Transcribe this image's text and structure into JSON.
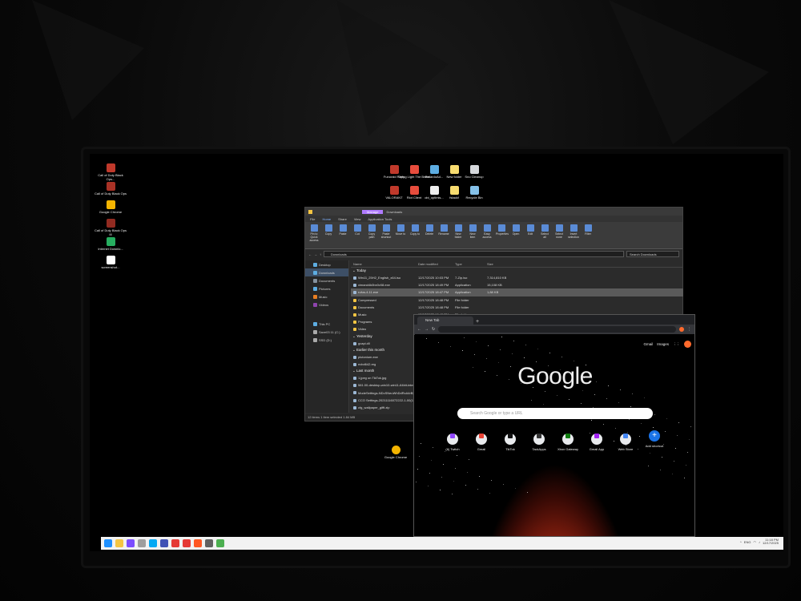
{
  "desktop": {
    "left_icons": [
      {
        "label": "Call of Duty Black Ops...",
        "color": "#c0392b"
      },
      {
        "label": "Call of Duty Black Ops",
        "color": "#a93226"
      },
      {
        "label": "Google Chrome",
        "color": "#f4b400"
      },
      {
        "label": "Call of Duty Black Ops III",
        "color": "#922b21"
      },
      {
        "label": "Internet Downlo...",
        "color": "#27ae60"
      },
      {
        "label": "screenshot...",
        "color": "#ffffff"
      }
    ],
    "top_icons": [
      {
        "label": "Funoraid Party",
        "color": "#c0392b"
      },
      {
        "label": "Dying Light The Beast",
        "color": "#e74c3c"
      },
      {
        "label": "RetardoAd...",
        "color": "#5dade2"
      },
      {
        "label": "New folder",
        "color": "#f7dc6f"
      },
      {
        "label": "Sno Cleanup",
        "color": "#d5d8dc"
      },
      {
        "label": "VALORANT",
        "color": "#c0392b"
      },
      {
        "label": "Riot Client",
        "color": "#e74c3c"
      },
      {
        "label": "obi_optimis...",
        "color": "#eeeeee"
      },
      {
        "label": "fstackf",
        "color": "#f7dc6f"
      },
      {
        "label": "Recycle Bin",
        "color": "#85c1e9"
      }
    ],
    "lower_icon": {
      "label": "Google Chrome",
      "color": "#f4b400"
    }
  },
  "explorer": {
    "title": "Downloads",
    "manage_tab": "Manage",
    "ribbon_tabs": [
      "File",
      "Home",
      "Share",
      "View",
      "Application Tools"
    ],
    "ribbon_buttons": [
      "Pin to Quick access",
      "Copy",
      "Paste",
      "Cut",
      "Copy path",
      "Paste shortcut",
      "Move to",
      "Copy to",
      "Delete",
      "Rename",
      "New folder",
      "New item",
      "Easy access",
      "Properties",
      "Open",
      "Edit",
      "Select all",
      "Select none",
      "Invert selection",
      "Filter"
    ],
    "ribbon_groups": [
      "Clipboard",
      "Organize",
      "New",
      "Open",
      "Select",
      "Filter"
    ],
    "address": "Downloads",
    "search_placeholder": "Search Downloads",
    "nav_items": [
      {
        "label": "Desktop",
        "color": "#5dade2"
      },
      {
        "label": "Downloads",
        "color": "#5dade2"
      },
      {
        "label": "Documents",
        "color": "#85929e"
      },
      {
        "label": "Pictures",
        "color": "#5dade2"
      },
      {
        "label": "Music",
        "color": "#e67e22"
      },
      {
        "label": "Videos",
        "color": "#8e44ad"
      },
      {
        "label": "This PC",
        "color": "#5dade2"
      },
      {
        "label": "Save03 11 (C:)",
        "color": "#aaa"
      },
      {
        "label": "SSD (D:)",
        "color": "#aaa"
      }
    ],
    "columns": [
      "Name",
      "Date modified",
      "Type",
      "Size"
    ],
    "groups": [
      {
        "title": "Today",
        "rows": [
          [
            "Win11_25H2_English_x64.iso",
            "12/17/2025 10:03 PM",
            "7-Zip.iso",
            "7,314,810 KB"
          ],
          [
            "ximand4k0bx0v08.exe",
            "12/17/2025 18:49 PM",
            "Application",
            "15,108 KB"
          ],
          [
            "rufus-4.11.exe",
            "12/17/2025 18:47 PM",
            "Application",
            "1,88 KB"
          ],
          [
            "Compressed",
            "12/17/2025 18:48 PM",
            "File folder",
            ""
          ],
          [
            "Documents",
            "12/17/2025 18:48 PM",
            "File folder",
            ""
          ],
          [
            "Music",
            "12/17/2025 18:48 PM",
            "File folder",
            ""
          ],
          [
            "Programs",
            "12/17/2025 18:48 PM",
            "File folder",
            ""
          ],
          [
            "Video",
            "12/17/2025 18:48 PM",
            "File folder",
            ""
          ]
        ]
      },
      {
        "title": "Yesterday",
        "rows": [
          [
            "gcapi.dll",
            "",
            "",
            ""
          ]
        ]
      },
      {
        "title": "Earlier this month",
        "rows": [
          [
            "plutonium.exe",
            "",
            "",
            ""
          ],
          [
            "nvbd642.reg",
            "",
            "",
            ""
          ]
        ]
      },
      {
        "title": "Last month",
        "rows": [
          [
            "1.jpeg on TikTok.jpg",
            "",
            "",
            ""
          ],
          [
            "581.00-desktop-win10-win11-64bit-intern...",
            "",
            "",
            ""
          ],
          [
            "ModeSettings-NDcSNeuWhDdRcA4rBy8...",
            "",
            "",
            ""
          ],
          [
            "CCO Settings-20211116072222-1-00(1).cfg",
            "",
            "",
            ""
          ],
          [
            "cfg_wallpaper_gifft.zip",
            "",
            "",
            ""
          ]
        ]
      }
    ],
    "status": "12 items    1 item selected  1.84 MB"
  },
  "chrome": {
    "tab_title": "New Tab",
    "omnibox_placeholder": "",
    "top_links": [
      "Gmail",
      "Images"
    ],
    "logo": "Google",
    "search_placeholder": "Search Google or type a URL",
    "shortcuts": [
      {
        "label": "(6) Twitch",
        "color": "#9146ff"
      },
      {
        "label": "Gmail",
        "color": "#ea4335"
      },
      {
        "label": "TikTok",
        "color": "#111111"
      },
      {
        "label": "TackApps",
        "color": "#333333"
      },
      {
        "label": "Xbox Gateway",
        "color": "#107c10"
      },
      {
        "label": "Gmail App",
        "color": "#a020f0"
      },
      {
        "label": "Web Store",
        "color": "#4285f4"
      },
      {
        "label": "Add shortcut",
        "color": "#1a73e8"
      }
    ],
    "accent": "#ff6a2c"
  },
  "taskbar": {
    "apps": [
      {
        "name": "start-icon",
        "color": "#1e90ff"
      },
      {
        "name": "explorer-icon",
        "color": "#f4c542"
      },
      {
        "name": "widget-icon",
        "color": "#7c4dff"
      },
      {
        "name": "app-icon",
        "color": "#9e9e9e"
      },
      {
        "name": "media-icon",
        "color": "#03a9f4"
      },
      {
        "name": "game-icon",
        "color": "#3f51b5"
      },
      {
        "name": "store-icon",
        "color": "#e53935"
      },
      {
        "name": "youtube-icon",
        "color": "#e53935"
      },
      {
        "name": "record-icon",
        "color": "#ff5722"
      },
      {
        "name": "edit-icon",
        "color": "#616161"
      },
      {
        "name": "chrome-icon",
        "color": "#4caf50"
      }
    ],
    "tray": {
      "lang": "ENG",
      "time": "11:18 PM",
      "date": "12/17/2025"
    }
  }
}
